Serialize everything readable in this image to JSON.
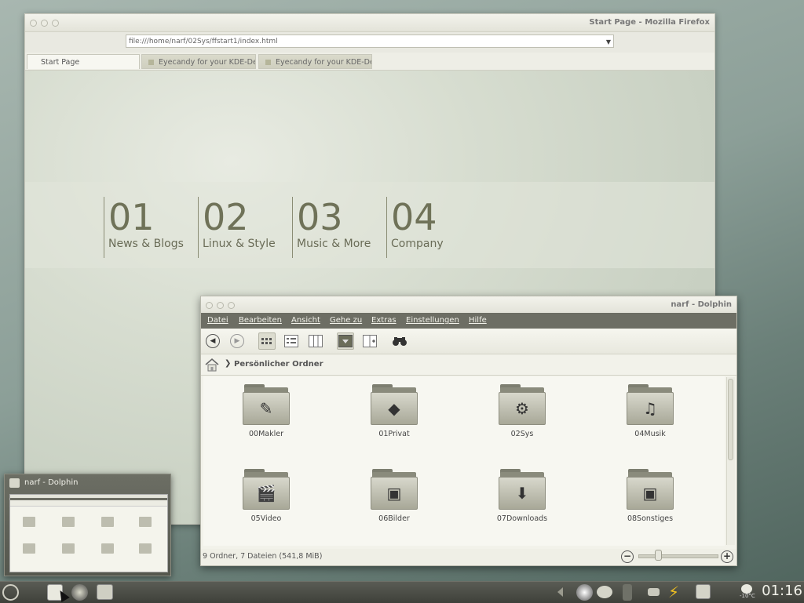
{
  "firefox": {
    "title": "Start Page - Mozilla Firefox",
    "url": "file:///home/narf/02Sys/ffstart1/index.html",
    "tabs": [
      {
        "label": "Start Page"
      },
      {
        "label": "Eyecandy for your KDE-De..."
      },
      {
        "label": "Eyecandy for your KDE-De..."
      }
    ],
    "sections": [
      {
        "num": "01",
        "label": "News & Blogs"
      },
      {
        "num": "02",
        "label": "Linux & Style"
      },
      {
        "num": "03",
        "label": "Music & More"
      },
      {
        "num": "04",
        "label": "Company"
      }
    ]
  },
  "dolphin": {
    "title": "narf - Dolphin",
    "menu": [
      "Datei",
      "Bearbeiten",
      "Ansicht",
      "Gehe zu",
      "Extras",
      "Einstellungen",
      "Hilfe"
    ],
    "breadcrumb": "Persönlicher Ordner",
    "files": [
      {
        "name": "00Makler",
        "icon": "document-folder-icon"
      },
      {
        "name": "01Privat",
        "icon": "private-folder-icon"
      },
      {
        "name": "02Sys",
        "icon": "system-folder-icon"
      },
      {
        "name": "04Musik",
        "icon": "music-folder-icon"
      },
      {
        "name": "05Video",
        "icon": "video-folder-icon"
      },
      {
        "name": "06Bilder",
        "icon": "pictures-folder-icon"
      },
      {
        "name": "07Downloads",
        "icon": "downloads-folder-icon"
      },
      {
        "name": "08Sonstiges",
        "icon": "misc-folder-icon"
      }
    ],
    "status": "9 Ordner, 7 Dateien (541,8 MiB)",
    "zoom_level": 0.25
  },
  "preview": {
    "title": "narf - Dolphin"
  },
  "taskbar": {
    "clock": "01:16",
    "temperature": "-10°C"
  },
  "colors": {
    "menubar": "#6d6e64",
    "accent_text": "#6f7258",
    "taskbar": "#3e403a"
  }
}
